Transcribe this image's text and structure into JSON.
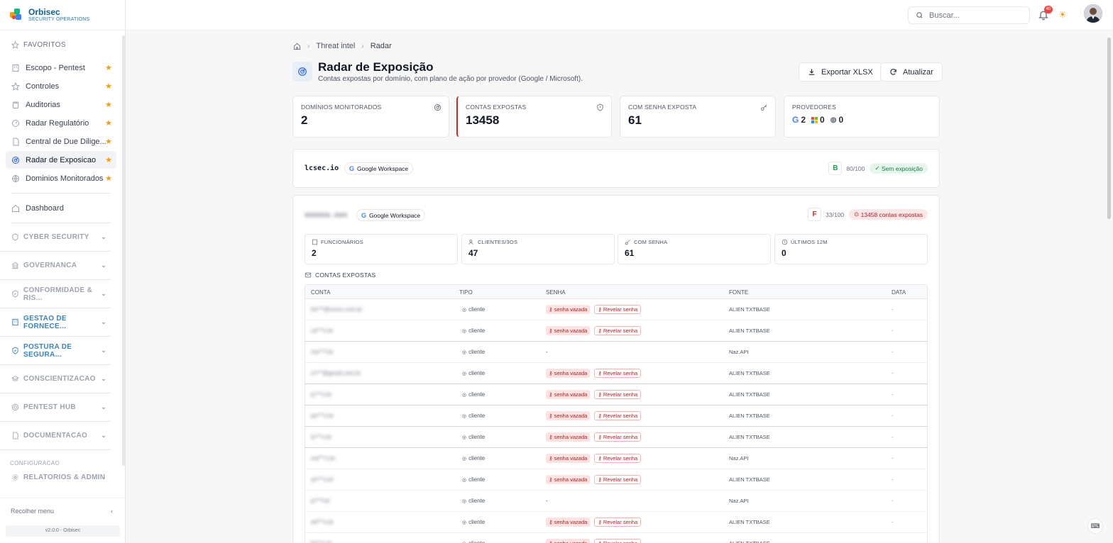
{
  "brand": {
    "name": "Orbisec",
    "subtitle": "SECURITY OPERATIONS"
  },
  "sidebar": {
    "favorites_label": "FAVORITOS",
    "favorites": [
      {
        "label": "Escopo - Pentest",
        "icon": "building-icon"
      },
      {
        "label": "Controles",
        "icon": "star-outline-icon"
      },
      {
        "label": "Auditorias",
        "icon": "clipboard-icon"
      },
      {
        "label": "Radar Regulatório",
        "icon": "gauge-icon"
      },
      {
        "label": "Central de Due Dilige...",
        "icon": "document-icon"
      },
      {
        "label": "Radar de Exposicao",
        "icon": "radar-icon",
        "active": true
      },
      {
        "label": "Dominios Monitorados",
        "icon": "globe-icon"
      }
    ],
    "dashboard_label": "Dashboard",
    "groups": [
      {
        "label": "CYBER SECURITY",
        "icon": "shield-icon"
      },
      {
        "label": "GOVERNANCA",
        "icon": "bank-icon"
      },
      {
        "label": "CONFORMIDADE & RIS...",
        "icon": "shield-check-icon"
      },
      {
        "label": "GESTAO DE FORNECE...",
        "icon": "building-icon",
        "blue": true
      },
      {
        "label": "POSTURA DE SEGURA...",
        "icon": "shield-check-icon",
        "blue": true
      },
      {
        "label": "CONSCIENTIZACAO",
        "icon": "graduation-icon"
      },
      {
        "label": "PENTEST HUB",
        "icon": "target-icon"
      },
      {
        "label": "DOCUMENTACAO",
        "icon": "document-icon"
      }
    ],
    "config_label": "CONFIGURACAO",
    "reports_label": "RELATORIOS & ADMIN",
    "collapse_label": "Recolher menu",
    "version": "v2.0.0 - Orbisec"
  },
  "topbar": {
    "search_placeholder": "Buscar...",
    "notifications": "40"
  },
  "breadcrumb": {
    "parent": "Threat intel",
    "current": "Radar"
  },
  "page": {
    "title": "Radar de Exposição",
    "subtitle": "Contas expostas por domínio, com plano de ação por provedor (Google / Microsoft).",
    "export_label": "Exportar XLSX",
    "refresh_label": "Atualizar"
  },
  "stats": {
    "domains": {
      "label": "DOMÍNIOS MONITORADOS",
      "value": "2"
    },
    "exposed": {
      "label": "CONTAS EXPOSTAS",
      "value": "13458"
    },
    "password": {
      "label": "COM SENHA EXPOSTA",
      "value": "61"
    },
    "providers": {
      "label": "PROVEDORES",
      "google": "2",
      "microsoft": "0",
      "other": "0"
    }
  },
  "domain1": {
    "name": "lcsec.io",
    "provider": "Google Workspace",
    "grade": "B",
    "score": "80/100",
    "status": "Sem exposição",
    "grade_color": "#16a34a"
  },
  "domain2": {
    "name": "xxxxxx.xxx",
    "provider": "Google Workspace",
    "grade": "F",
    "score": "33/100",
    "status": "13458 contas expostas",
    "grade_color": "#dc2626",
    "metrics": {
      "employees": {
        "label": "FUNCIONÁRIOS",
        "value": "2"
      },
      "clients": {
        "label": "CLIENTES/3OS",
        "value": "47"
      },
      "with_password": {
        "label": "COM SENHA",
        "value": "61"
      },
      "last12m": {
        "label": "ÚLTIMOS 12M",
        "value": "0"
      }
    }
  },
  "accounts": {
    "title": "CONTAS EXPOSTAS",
    "headers": {
      "account": "CONTA",
      "type": "TIPO",
      "password": "SENHA",
      "source": "FONTE",
      "date": "DATA"
    },
    "leak_label": "senha vazada",
    "reveal_label": "Revelar senha",
    "rows": [
      {
        "account": "ka***@xxxxx.com.br",
        "type": "cliente",
        "leaked": true,
        "source": "ALIEN TXTBASE",
        "date": "-"
      },
      {
        "account": "ca***o.br",
        "type": "cliente",
        "leaked": true,
        "source": "ALIEN TXTBASE",
        "date": "-"
      },
      {
        "account": "ma***l.br",
        "type": "cliente",
        "leaked": false,
        "password": "-",
        "source": "Naz.API",
        "date": "-"
      },
      {
        "account": "ro***@gmail.com.br",
        "type": "cliente",
        "leaked": true,
        "source": "ALIEN TXTBASE",
        "date": "-"
      },
      {
        "account": "ju***o.br",
        "type": "cliente",
        "leaked": true,
        "source": "ALIEN TXTBASE",
        "date": "-"
      },
      {
        "account": "pa***o.br",
        "type": "cliente",
        "leaked": true,
        "source": "ALIEN TXTBASE",
        "date": "-"
      },
      {
        "account": "lu***o.br",
        "type": "cliente",
        "leaked": true,
        "source": "ALIEN TXTBASE",
        "date": "-"
      },
      {
        "account": "ma***o.br",
        "type": "cliente",
        "leaked": true,
        "source": "Naz.API",
        "date": "-"
      },
      {
        "account": "an***o.br",
        "type": "cliente",
        "leaked": true,
        "source": "ALIEN TXTBASE",
        "date": "-"
      },
      {
        "account": "jo***l.br",
        "type": "cliente",
        "leaked": false,
        "password": "-",
        "source": "Naz.API",
        "date": "-"
      },
      {
        "account": "ed***o.br",
        "type": "cliente",
        "leaked": true,
        "source": "ALIEN TXTBASE",
        "date": "-"
      },
      {
        "account": "fe***o.br",
        "type": "cliente",
        "leaked": true,
        "source": "ALIEN TXTBASE",
        "date": "-"
      }
    ]
  }
}
